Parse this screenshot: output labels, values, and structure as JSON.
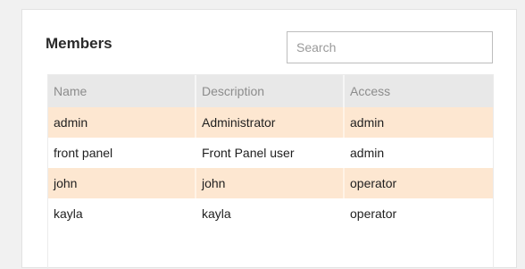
{
  "panel": {
    "title": "Members",
    "search": {
      "placeholder": "Search",
      "value": ""
    }
  },
  "table": {
    "columns": [
      "Name",
      "Description",
      "Access"
    ],
    "rows": [
      {
        "name": "admin",
        "description": "Administrator",
        "access": "admin",
        "highlight": true
      },
      {
        "name": "front panel",
        "description": "Front Panel user",
        "access": "admin",
        "highlight": false
      },
      {
        "name": "john",
        "description": "john",
        "access": "operator",
        "highlight": true
      },
      {
        "name": "kayla",
        "description": "kayla",
        "access": "operator",
        "highlight": false
      }
    ]
  },
  "colors": {
    "header_bg": "#e8e8e8",
    "highlight_row": "#fde7d1"
  }
}
